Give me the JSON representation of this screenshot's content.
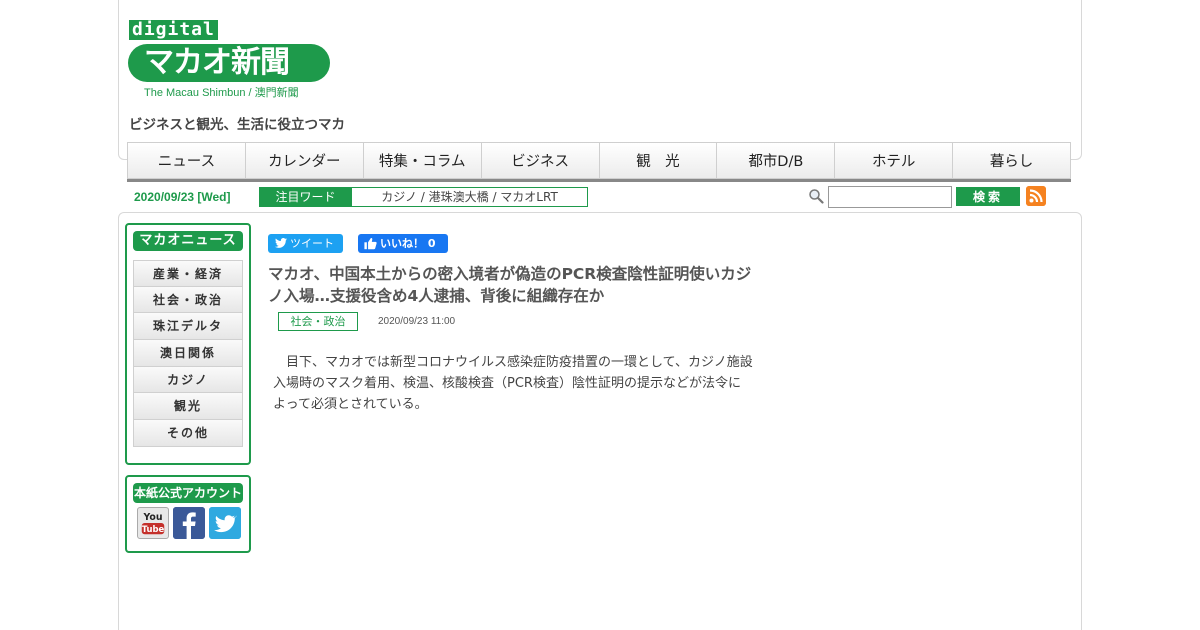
{
  "logo": {
    "digital": "digital",
    "name": "マカオ新聞",
    "sub": "The Macau Shimbun / 澳門新聞"
  },
  "tagline": "ビジネスと観光、生活に役立つマカ",
  "nav": [
    "ニュース",
    "カレンダー",
    "特集・コラム",
    "ビジネス",
    "観　光",
    "都市D/B",
    "ホテル",
    "暮らし"
  ],
  "date": "2020/09/23 [Wed]",
  "hot_words": {
    "label": "注目ワード",
    "words": "カジノ / 港珠澳大橋 / マカオLRT"
  },
  "search": {
    "value": "",
    "button": "検索"
  },
  "sidebar": {
    "news_title": "マカオニュース",
    "items": [
      "産業・経済",
      "社会・政治",
      "珠江デルタ",
      "澳日関係",
      "カジノ",
      "観光",
      "その他"
    ],
    "official_title": "本紙公式アカウント"
  },
  "social": {
    "tweet": "ツイート",
    "like": "いいね！ 0"
  },
  "article": {
    "title": "マカオ、中国本土からの密入境者が偽造のPCR検査陰性証明使いカジノ入場…支援役含め4人逮捕、背後に組織存在か",
    "category": "社会・政治",
    "published": "2020/09/23 11:00",
    "body": "目下、マカオでは新型コロナウイルス感染症防疫措置の一環として、カジノ施設入場時のマスク着用、検温、核酸検査（PCR検査）陰性証明の提示などが法令によって必須とされている。"
  },
  "colors": {
    "brand_green": "#1e9a4b",
    "twitter_blue": "#1da1f2",
    "facebook_blue": "#1877f2",
    "rss_orange": "#f58220"
  }
}
